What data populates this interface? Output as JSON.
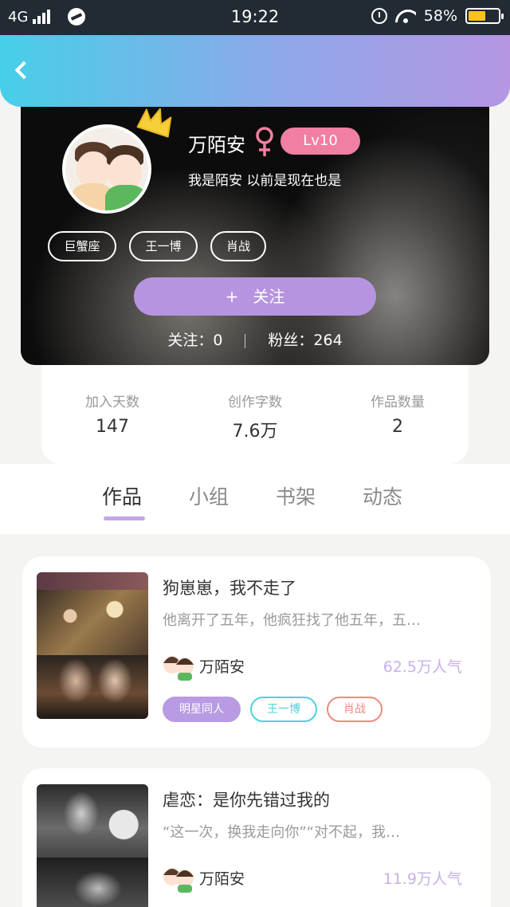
{
  "status_bar": {
    "network": "4G",
    "time": "19:22",
    "battery": "58%",
    "battery_level": 0.58
  },
  "profile": {
    "name": "万陌安",
    "level": "Lv10",
    "bio": "我是陌安 以前是现在也是",
    "tags": [
      "巨蟹座",
      "王一博",
      "肖战"
    ],
    "follow_label": "关注",
    "following_text": "关注：0",
    "fans_text": "粉丝：264"
  },
  "stats": [
    {
      "label": "加入天数",
      "value": "147"
    },
    {
      "label": "创作字数",
      "value": "7.6万"
    },
    {
      "label": "作品数量",
      "value": "2"
    }
  ],
  "tabs": [
    "作品",
    "小组",
    "书架",
    "动态"
  ],
  "works": [
    {
      "title": "狗崽崽，我不走了",
      "desc": "他离开了五年，他疯狂找了他五年，五…",
      "author": "万陌安",
      "popularity": "62.5万人气",
      "tags": [
        {
          "label": "明星同人",
          "color": "#b99be3",
          "filled": true
        },
        {
          "label": "王一博",
          "color": "#4fd0dd",
          "filled": false
        },
        {
          "label": "肖战",
          "color": "#ef8a7d",
          "filled": false
        }
      ]
    },
    {
      "title": "虐恋：是你先错过我的",
      "desc": "“这一次，换我走向你”“对不起，我…",
      "author": "万陌安",
      "popularity": "11.9万人气"
    }
  ],
  "colors": {
    "header_start": "#46cfe8",
    "header_end": "#b596e3",
    "accent": "#b694e0",
    "level_badge": "#f07fa1"
  }
}
